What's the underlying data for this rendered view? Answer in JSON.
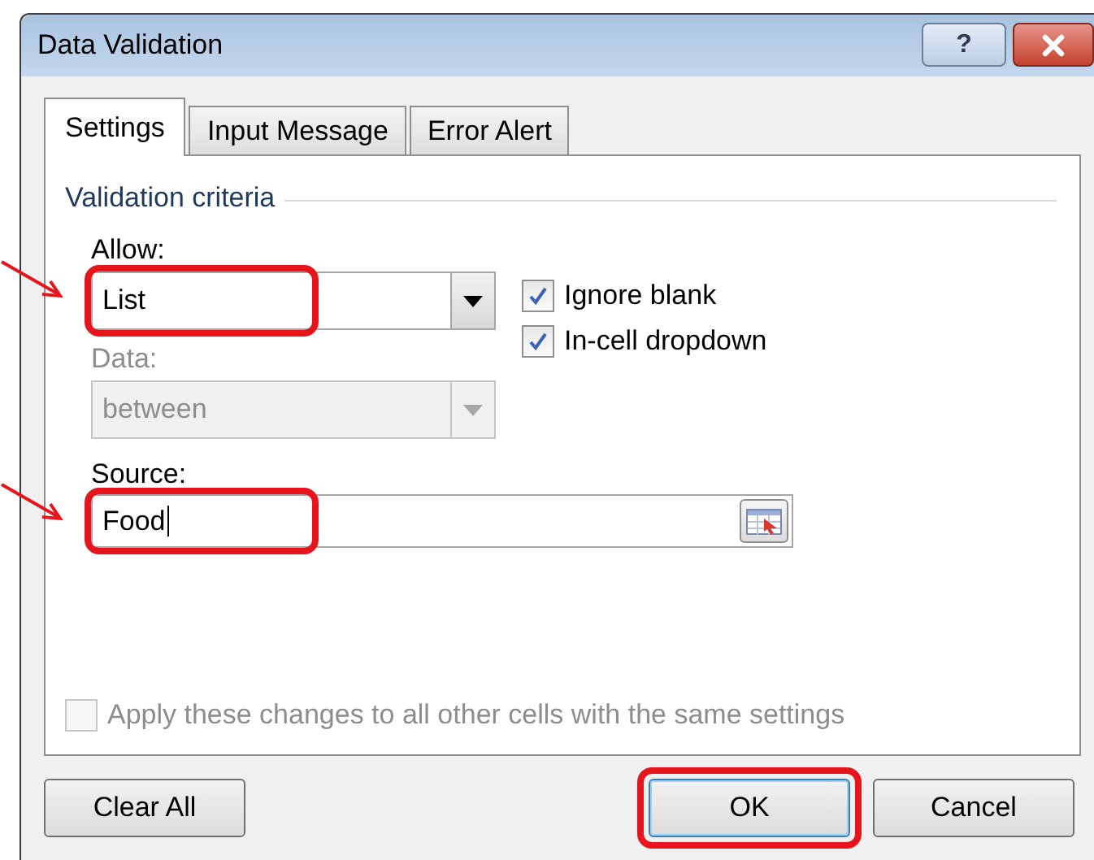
{
  "window": {
    "title": "Data Validation",
    "buttons": [
      {
        "kind": "help",
        "label": "?"
      },
      {
        "kind": "close"
      }
    ]
  },
  "tabs": [
    {
      "label": "Settings",
      "selected": true
    },
    {
      "label": "Input Message",
      "selected": false
    },
    {
      "label": "Error Alert",
      "selected": false
    }
  ],
  "group_title": "Validation criteria",
  "allow": {
    "label": "Allow:",
    "value": "List",
    "disabled": false,
    "highlighted": true,
    "arrow": true
  },
  "data": {
    "label": "Data:",
    "value": "between",
    "disabled": true
  },
  "checkboxes": [
    {
      "label": "Ignore blank",
      "checked": true,
      "disabled": false
    },
    {
      "label": "In-cell dropdown",
      "checked": true,
      "disabled": false
    }
  ],
  "source": {
    "label": "Source:",
    "value": "Food",
    "highlighted": true,
    "arrow": true
  },
  "apply_all": {
    "label": "Apply these changes to all other cells with the same settings",
    "checked": false,
    "disabled": true
  },
  "buttons": [
    {
      "label": "Clear All",
      "highlighted": false
    },
    {
      "label": "OK",
      "highlighted": true,
      "default": true
    },
    {
      "label": "Cancel",
      "highlighted": false
    }
  ]
}
